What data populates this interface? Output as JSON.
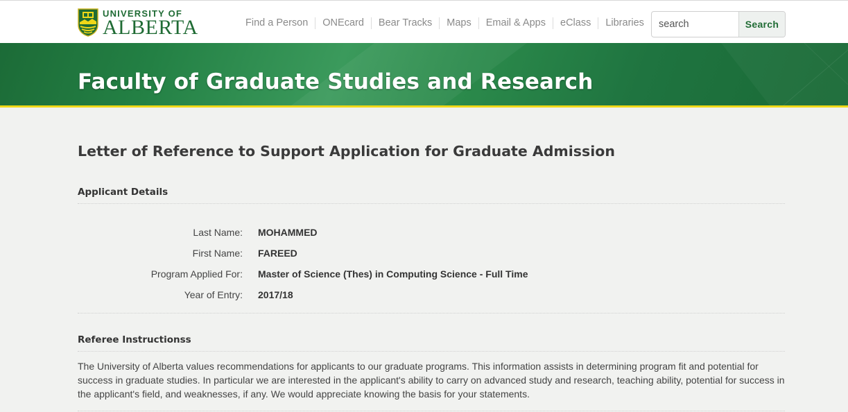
{
  "logo": {
    "line1": "UNIVERSITY OF",
    "line2": "ALBERTA"
  },
  "nav": [
    {
      "label": "Find a Person"
    },
    {
      "label": "ONEcard"
    },
    {
      "label": "Bear Tracks"
    },
    {
      "label": "Maps"
    },
    {
      "label": "Email & Apps"
    },
    {
      "label": "eClass"
    },
    {
      "label": "Libraries"
    }
  ],
  "search": {
    "placeholder": "search",
    "button": "Search"
  },
  "banner": {
    "title": "Faculty of Graduate Studies and Research"
  },
  "page": {
    "title": "Letter of Reference to Support Application for Graduate Admission"
  },
  "applicant": {
    "heading": "Applicant Details",
    "fields": [
      {
        "label": "Last Name:",
        "value": "MOHAMMED"
      },
      {
        "label": "First Name:",
        "value": "FAREED"
      },
      {
        "label": "Program Applied For:",
        "value": "Master of Science (Thes) in Computing Science - Full Time"
      },
      {
        "label": "Year of Entry:",
        "value": "2017/18"
      }
    ]
  },
  "instructions": {
    "heading": "Referee Instructionss",
    "text": "The University of Alberta values recommendations for applicants to our graduate programs. This information assists in determining program fit and potential for success in graduate studies. In particular we are interested in the applicant's ability to carry on advanced study and research, teaching ability, potential for success in the applicant's field, and weaknesses, if any. We would appreciate knowing the basis for your statements."
  },
  "colors": {
    "brand_green": "#1f6b34",
    "banner_green": "#238044",
    "accent_gold": "#f0d818"
  }
}
